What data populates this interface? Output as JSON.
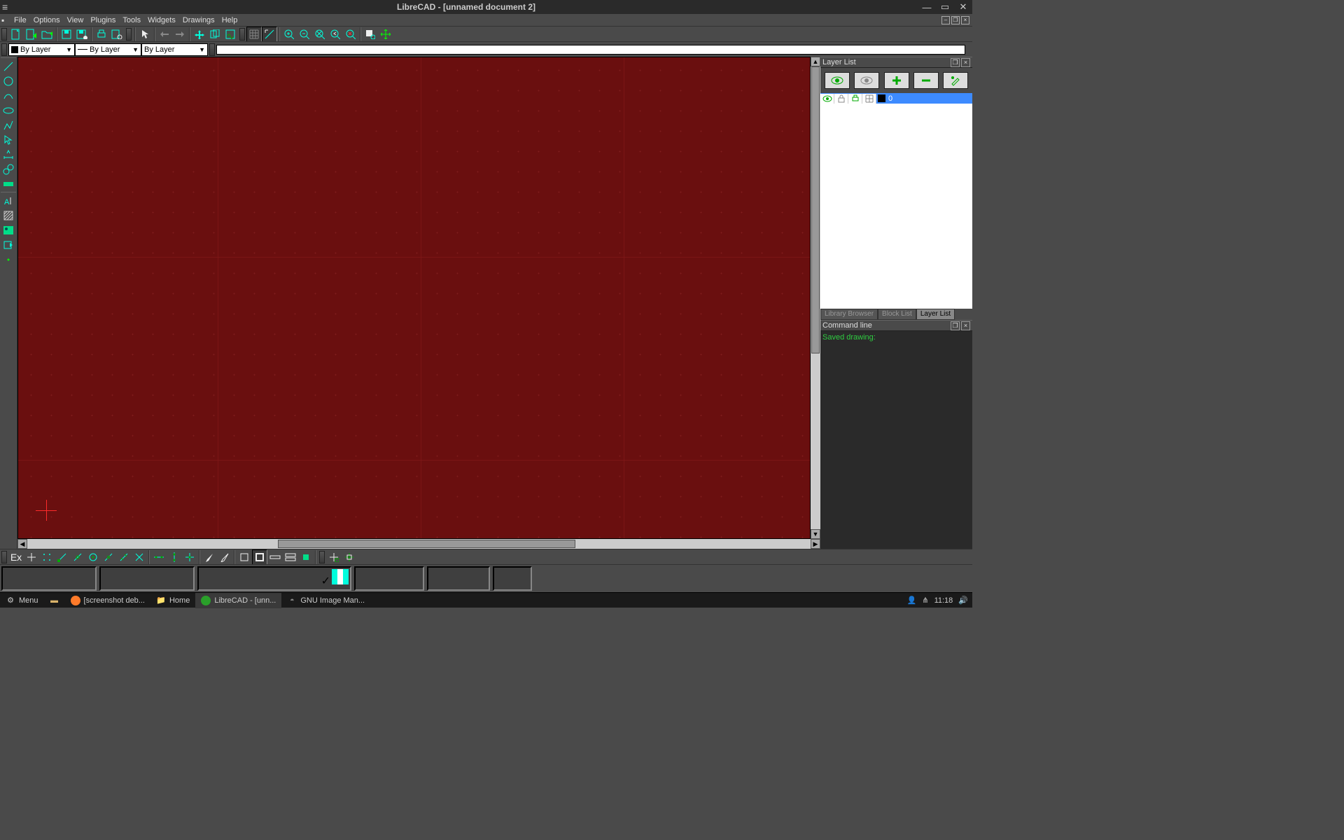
{
  "title": "LibreCAD - [unnamed document 2]",
  "menus": [
    "File",
    "Options",
    "View",
    "Plugins",
    "Tools",
    "Widgets",
    "Drawings",
    "Help"
  ],
  "combo": {
    "color": "By Layer",
    "width": "By Layer",
    "style": "By Layer"
  },
  "panels": {
    "layerList": {
      "title": "Layer List",
      "layers": [
        {
          "name": "0"
        }
      ]
    },
    "tabs": [
      "Library Browser",
      "Block List",
      "Layer List"
    ],
    "cmd": {
      "title": "Command line",
      "msg": "Saved drawing:"
    }
  },
  "snap": {
    "ex": "Ex"
  },
  "taskbar": {
    "menu": "Menu",
    "items": [
      {
        "label": "[screenshot deb...",
        "color": "#ff7b2a"
      },
      {
        "label": "Home",
        "color": "#d9b36a"
      },
      {
        "label": "LibreCAD - [unn...",
        "color": "#2aa02a",
        "active": true
      },
      {
        "label": "GNU Image Man...",
        "color": "#888"
      }
    ],
    "clock": "11:18"
  }
}
